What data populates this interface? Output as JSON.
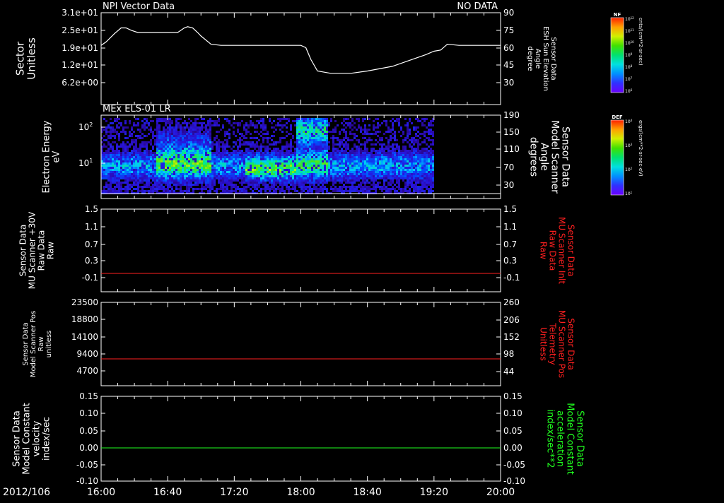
{
  "figure": {
    "date_label": "2012/106",
    "time_ticks": [
      "16:00",
      "16:40",
      "17:20",
      "18:00",
      "18:40",
      "19:20",
      "20:00"
    ],
    "time_range": [
      0,
      240
    ]
  },
  "panels": [
    {
      "id": "npi",
      "title": "NPI Vector Data",
      "right_title": "NO DATA",
      "left_label": [
        "Sector",
        "Unitless"
      ],
      "left_ticks": [
        "3.1e+01",
        "2.5e+01",
        "1.9e+01",
        "1.2e+01",
        "6.2e+00"
      ],
      "right_label": [
        "Sensor Data",
        "ESH Sun Elevation",
        "Angle",
        "degree"
      ],
      "right_label_color": "#ffffff",
      "right_ticks": [
        "90",
        "75",
        "60",
        "45",
        "30"
      ],
      "colorbar": {
        "tag": "NF",
        "unit": "cnts/(cm**2-sr-sec)",
        "ticks": [
          "10^12",
          "10^11",
          "10^10",
          "10^9",
          "10^8",
          "10^7",
          "10^6"
        ]
      }
    },
    {
      "id": "els",
      "title": "MEx ELS-01 LR",
      "left_label": [
        "Electron Energy",
        "eV"
      ],
      "left_ticks": [
        "10^2",
        "10^1"
      ],
      "right_label": [
        "Sensor Data",
        "Model Scanner",
        "Angle",
        "degrees"
      ],
      "right_label_color": "#ffffff",
      "right_ticks": [
        "190",
        "150",
        "110",
        "70",
        "30"
      ],
      "colorbar": {
        "tag": "DEF",
        "unit": "ergs/(cm**2-sr-sec-eV)",
        "ticks": [
          "10^4",
          "10^3",
          "10^2",
          "10^1"
        ]
      }
    },
    {
      "id": "mu30",
      "left_label": [
        "Sensor Data",
        "MU Scanner +30V",
        "Raw Data",
        "Raw"
      ],
      "left_ticks": [
        "1.5",
        "1.1",
        "0.7",
        "0.3",
        "-0.1"
      ],
      "right_label": [
        "Sensor Data",
        "MU Scanner Inlt",
        "Raw Data",
        "Raw"
      ],
      "right_label_color": "#ff2020",
      "right_ticks": [
        "1.5",
        "1.1",
        "0.7",
        "0.3",
        "-0.1"
      ],
      "line_color": "#ff2020"
    },
    {
      "id": "mupos",
      "left_label": [
        "Sensor Data",
        "Model Scanner Pos",
        "Raw",
        "unitless"
      ],
      "left_ticks": [
        "23500",
        "18800",
        "14100",
        "9400",
        "4700"
      ],
      "right_label": [
        "Sensor Data",
        "MU Scanner Pos",
        "Telemetry",
        "Unitless"
      ],
      "right_label_color": "#ff2020",
      "right_ticks": [
        "260",
        "206",
        "152",
        "98",
        "44"
      ],
      "line_color": "#ff2020"
    },
    {
      "id": "model",
      "left_label": [
        "Sensor Data",
        "Model Constant",
        "velocity",
        "index/sec"
      ],
      "left_ticks": [
        "0.15",
        "0.10",
        "0.05",
        "0.00",
        "-0.05",
        "-0.10"
      ],
      "right_label": [
        "Sensor Data",
        "Model Constant",
        "acceleration",
        "index/sec**2"
      ],
      "right_label_color": "#20ff20",
      "right_ticks": [
        "0.15",
        "0.10",
        "0.05",
        "0.00",
        "-0.05",
        "-0.10"
      ],
      "line_color": "#20ff20"
    }
  ],
  "chart_data": [
    {
      "type": "line",
      "title": "NPI Vector Data",
      "ylabel": "Sensor Data ESH Sun Elevation Angle degree",
      "ylim": [
        20,
        90
      ],
      "x_unit": "minutes after 16:00",
      "series": [
        {
          "name": "ESH Sun Elevation",
          "x": [
            0,
            3,
            8,
            12,
            15,
            18,
            22,
            28,
            34,
            38,
            42,
            46,
            50,
            52,
            55,
            58,
            60,
            66,
            72,
            80,
            90,
            100,
            110,
            116,
            120,
            123,
            126,
            130,
            138,
            150,
            160,
            175,
            185,
            195,
            200,
            204,
            208,
            215,
            225,
            240
          ],
          "y": [
            62,
            65,
            72,
            77,
            77,
            75,
            73,
            73,
            73,
            73,
            73,
            73,
            77,
            78,
            77,
            73,
            70,
            63,
            62,
            62,
            62,
            62,
            62,
            62,
            62,
            60,
            50,
            40,
            38,
            38,
            40,
            44,
            49,
            54,
            57,
            58,
            63,
            62,
            62,
            62
          ]
        }
      ]
    },
    {
      "type": "heatmap",
      "title": "MEx ELS-01 LR",
      "ylabel": "Electron Energy eV",
      "note_valid_x": [
        0,
        200
      ],
      "xlim": [
        0,
        240
      ]
    },
    {
      "type": "line",
      "ylim": [
        -0.3,
        1.5
      ],
      "series": [
        {
          "name": "MU Scanner +30V",
          "x": [
            0,
            240
          ],
          "y": [
            -0.0,
            -0.0
          ]
        }
      ]
    },
    {
      "type": "line",
      "ylim": [
        0,
        23500
      ],
      "series": [
        {
          "name": "Model Scanner Pos",
          "x": [
            0,
            240
          ],
          "y": [
            7800,
            7800
          ]
        }
      ]
    },
    {
      "type": "line",
      "ylim": [
        -0.1,
        0.15
      ],
      "series": [
        {
          "name": "Model Constant velocity",
          "x": [
            0,
            240
          ],
          "y": [
            0.0,
            0.0
          ]
        }
      ]
    }
  ]
}
